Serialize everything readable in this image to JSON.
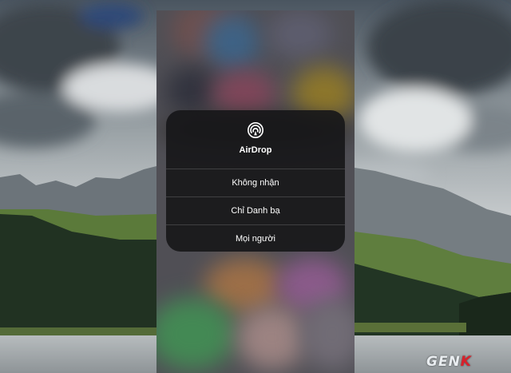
{
  "airdrop_menu": {
    "title": "AirDrop",
    "options": [
      {
        "label": "Không nhận"
      },
      {
        "label": "Chỉ Danh bạ"
      },
      {
        "label": "Mọi người"
      }
    ]
  },
  "watermark": {
    "brand_prefix": "GEN",
    "brand_suffix": "K"
  },
  "colors": {
    "menu_bg": "#161618",
    "accent_red": "#d9212b"
  },
  "icons": {
    "airdrop": "airdrop-icon"
  }
}
